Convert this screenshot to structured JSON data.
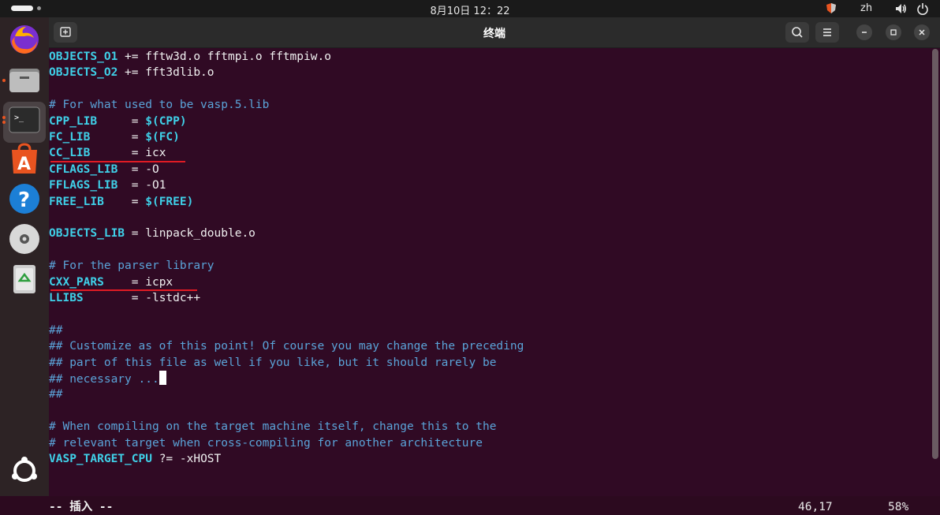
{
  "topbar": {
    "clock": "8月10日  12：22",
    "lang": "zh"
  },
  "dock": {
    "items": [
      "firefox-icon",
      "files-icon",
      "terminal-icon",
      "app-center-icon",
      "help-icon",
      "disc-icon",
      "trash-icon"
    ],
    "apps_grid": "show-apps-icon"
  },
  "window": {
    "title": "终端"
  },
  "colors": {
    "accent": "#e95420",
    "terminal_bg": "#300a24",
    "variable": "#3fd0e8",
    "comment": "#5aa3d8",
    "underline": "#e01b24"
  },
  "lines": [
    {
      "name": "OBJECTS_O1 ",
      "rest": "+= fftw3d.o fftmpi.o fftmpiw.o"
    },
    {
      "name": "OBJECTS_O2 ",
      "rest": "+= fft3dlib.o"
    },
    {
      "comment": "# For what used to be vasp.5.lib"
    },
    {
      "name": "CPP_LIB     ",
      "op": "= ",
      "kw": "$(CPP)"
    },
    {
      "name": "FC_LIB      ",
      "op": "= ",
      "kw": "$(FC)"
    },
    {
      "name": "CC_LIB      ",
      "op": "= ",
      "rest2": "icx"
    },
    {
      "name": "CFLAGS_LIB  ",
      "op": "= ",
      "rest2": "-O"
    },
    {
      "name": "FFLAGS_LIB  ",
      "op": "= ",
      "rest2": "-O1"
    },
    {
      "name": "FREE_LIB    ",
      "op": "= ",
      "kw": "$(FREE)"
    },
    {
      "name": "OBJECTS_LIB ",
      "op": "= ",
      "rest2": "linpack_double.o"
    },
    {
      "comment": "# For the parser library"
    },
    {
      "name": "CXX_PARS    ",
      "op": "= ",
      "rest2": "icpx"
    },
    {
      "name": "LLIBS       ",
      "op": "= ",
      "rest2": "-lstdc++"
    },
    {
      "comment": "##"
    },
    {
      "comment": "## Customize as of this point! Of course you may change the preceding"
    },
    {
      "comment": "## part of this file as well if you like, but it should rarely be"
    },
    {
      "comment": "## necessary ..."
    },
    {
      "comment": "##"
    },
    {
      "comment": "# When compiling on the target machine itself, change this to the"
    },
    {
      "comment": "# relevant target when cross-compiling for another architecture"
    },
    {
      "name": "VASP_TARGET_CPU ",
      "op": "?= ",
      "rest2": "-xHOST"
    }
  ],
  "status": {
    "mode": "-- 插入 --",
    "position": "46,17",
    "percent": "58%"
  }
}
